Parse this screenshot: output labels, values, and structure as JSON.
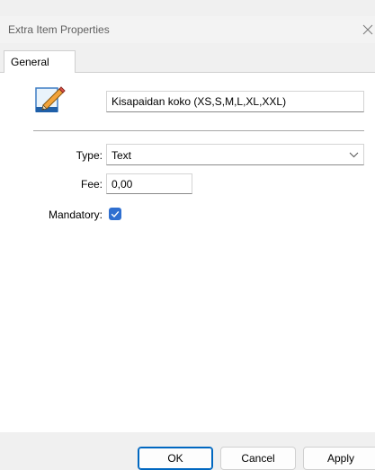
{
  "window": {
    "title": "Extra Item Properties"
  },
  "tabs": [
    {
      "label": "General"
    }
  ],
  "item": {
    "name": "Kisapaidan koko (XS,S,M,L,XL,XXL)"
  },
  "form": {
    "type_label": "Type:",
    "type_value": "Text",
    "fee_label": "Fee:",
    "fee_value": "0,00",
    "mandatory_label": "Mandatory:",
    "mandatory_checked": true
  },
  "buttons": {
    "ok": "OK",
    "cancel": "Cancel",
    "apply": "Apply"
  },
  "icons": {
    "item_icon": "pencil-edit-icon",
    "close": "close-icon",
    "dropdown": "chevron-down-icon"
  },
  "colors": {
    "checkbox_accent": "#2f6fd0",
    "default_button_border": "#0067c0"
  }
}
